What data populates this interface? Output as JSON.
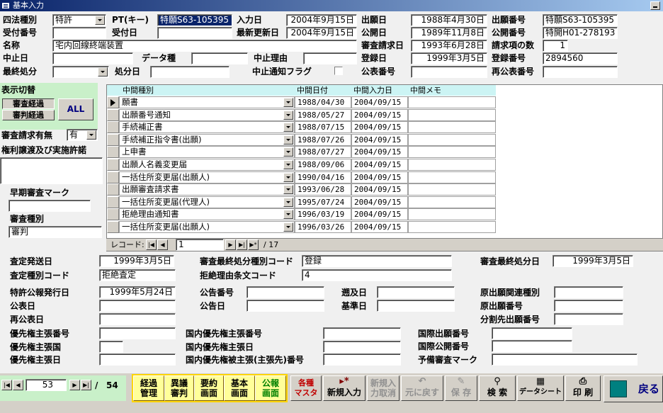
{
  "window": {
    "title": "基本入力"
  },
  "header": {
    "law_type_label": "四法種別",
    "law_type_value": "特許",
    "pt_key_label": "PT(キー)",
    "pt_key_value": "特願S63-105395",
    "entry_date_label": "入力日",
    "entry_date_value": "2004年9月15日",
    "app_date_label": "出願日",
    "app_date_value": "1988年4月30日",
    "app_no_label": "出願番号",
    "app_no_value": "特願S63-105395",
    "recv_no_label": "受付番号",
    "recv_no_value": "",
    "recv_date_label": "受付日",
    "recv_date_value": "",
    "last_update_label": "最新更新日",
    "last_update_value": "2004年9月15日",
    "pub_date_label": "公開日",
    "pub_date_value": "1989年11月8日",
    "pub_no_label": "公開番号",
    "pub_no_value": "特開H01-278193",
    "name_label": "名称",
    "name_value": "宅内回線終端装置",
    "exam_req_label": "審査請求日",
    "exam_req_value": "1993年6月28日",
    "claims_label": "請求項の数",
    "claims_value": "1",
    "stop_date_label": "中止日",
    "stop_date_value": "",
    "data_type_label": "データ種",
    "data_type_value": "",
    "stop_reason_label": "中止理由",
    "stop_reason_value": "",
    "reg_date_label": "登録日",
    "reg_date_value": "1999年3月5日",
    "reg_no_label": "登録番号",
    "reg_no_value": "2894560",
    "final_disp_label": "最終処分",
    "final_disp_value": "",
    "disp_date_label": "処分日",
    "disp_date_value": "",
    "stop_flag_label": "中止通知フラグ",
    "pub_ann_no_label": "公表番号",
    "pub_ann_no_value": "",
    "republish_no_label": "再公表番号",
    "republish_no_value": ""
  },
  "left_panel": {
    "display_switch_label": "表示切替",
    "btn_exam": "審査経過",
    "btn_trial": "審判経過",
    "btn_all": "ALL",
    "exam_req_flag_label": "審査請求有無",
    "exam_req_flag_value": "有",
    "rights_label": "権利譲渡及び実施許諾",
    "early_exam_label": "早期審査マーク",
    "early_exam_value": "",
    "exam_type_label": "審査種別",
    "exam_type_value": "審判"
  },
  "grid": {
    "columns": [
      "中間種別",
      "中間日付",
      "中間入力日",
      "中間メモ"
    ],
    "rows": [
      {
        "type": "願書",
        "date": "1988/04/30",
        "input": "2004/09/15",
        "memo": ""
      },
      {
        "type": "出願番号通知",
        "date": "1988/05/27",
        "input": "2004/09/15",
        "memo": ""
      },
      {
        "type": "手続補正書",
        "date": "1988/07/15",
        "input": "2004/09/15",
        "memo": ""
      },
      {
        "type": "手続補正指令書(出願)",
        "date": "1988/07/26",
        "input": "2004/09/15",
        "memo": ""
      },
      {
        "type": "上申書",
        "date": "1988/07/27",
        "input": "2004/09/15",
        "memo": ""
      },
      {
        "type": "出願人名義変更届",
        "date": "1988/09/06",
        "input": "2004/09/15",
        "memo": ""
      },
      {
        "type": "一括住所変更届(出願人)",
        "date": "1990/04/16",
        "input": "2004/09/15",
        "memo": ""
      },
      {
        "type": "出願審査請求書",
        "date": "1993/06/28",
        "input": "2004/09/15",
        "memo": ""
      },
      {
        "type": "一括住所変更届(代理人)",
        "date": "1995/07/24",
        "input": "2004/09/15",
        "memo": ""
      },
      {
        "type": "拒絶理由通知書",
        "date": "1996/03/19",
        "input": "2004/09/15",
        "memo": ""
      },
      {
        "type": "一括住所変更届(出願人)",
        "date": "1996/03/26",
        "input": "2004/09/15",
        "memo": ""
      }
    ],
    "nav_label": "レコード:",
    "current_record": "1",
    "total_records": "/ 17"
  },
  "lower": {
    "assess_send_label": "査定発送日",
    "assess_send_value": "1999年3月5日",
    "assess_code_label": "査定種別コード",
    "assess_code_value": "拒絶査定",
    "final_disp_code_label": "審査最終処分種別コード",
    "final_disp_code_value": "登録",
    "reject_code_label": "拒絶理由条文コード",
    "reject_code_value": "4",
    "exam_final_date_label": "審査最終処分日",
    "exam_final_date_value": "1999年3月5日",
    "gazette_date_label": "特許公報発行日",
    "gazette_date_value": "1999年5月24日",
    "kouhou_label": "公表日",
    "kouhou_value": "",
    "republish_date_label": "再公表日",
    "republish_date_value": "",
    "announce_no_label": "公告番号",
    "announce_no_value": "",
    "announce_date_label": "公告日",
    "announce_date_value": "",
    "retro_date_label": "遡及日",
    "retro_date_value": "",
    "base_date_label": "基準日",
    "base_date_value": "",
    "orig_relation_label": "原出願関連種別",
    "orig_relation_value": "",
    "orig_no_label": "原出願番号",
    "orig_no_value": "",
    "div_no_label": "分割先出願番号",
    "div_no_value": "",
    "prio_no_label": "優先権主張番号",
    "prio_no_value": "",
    "prio_country_label": "優先権主張国",
    "prio_country_value": "",
    "prio_date_label": "優先権主張日",
    "prio_date_value": "",
    "dom_prio_no_label": "国内優先権主張番号",
    "dom_prio_no_value": "",
    "dom_prio_date_label": "国内優先権主張日",
    "dom_prio_date_value": "",
    "dom_prio_claimed_label": "国内優先権被主張(主張先)番号",
    "dom_prio_claimed_value": "",
    "intl_app_no_label": "国際出願番号",
    "intl_app_no_value": "",
    "intl_pub_no_label": "国際公開番号",
    "intl_pub_no_value": "",
    "pre_exam_label": "予備審査マーク",
    "pre_exam_value": ""
  },
  "toolbar": {
    "record_current": "53",
    "record_total": "54",
    "btn_progress": "経過\n管理",
    "btn_opposition": "異議\n審判",
    "btn_summary": "要約\n画面",
    "btn_basic": "基本\n画面",
    "btn_gazette": "公報\n画面",
    "btn_master": "各種\nマスタ",
    "btn_new": "新規入力",
    "btn_cancel_new": "新規入\n力取消",
    "btn_undo": "元に戻す",
    "btn_save": "保 存",
    "btn_search": "検 索",
    "btn_datasheet": "データシート",
    "btn_print": "印 刷",
    "btn_back": "戻る"
  }
}
